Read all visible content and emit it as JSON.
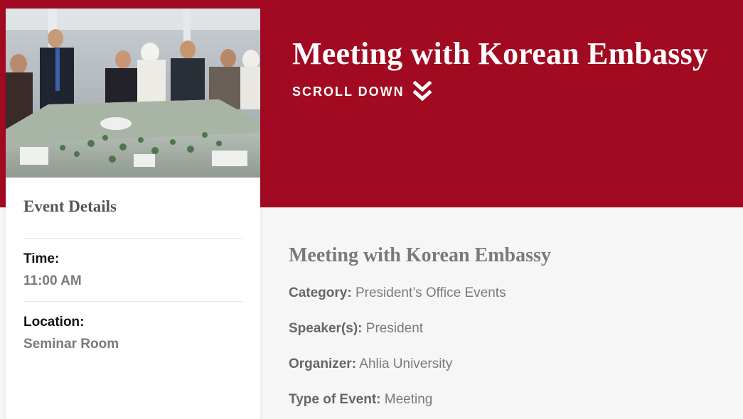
{
  "hero": {
    "title": "Meeting with Korean Embassy",
    "scroll_label": "SCROLL DOWN"
  },
  "colors": {
    "brand": "#a20a22",
    "background": "#f6f6f6",
    "muted_text": "#7a7a7a"
  },
  "event_details": {
    "heading": "Event Details",
    "time_label": "Time:",
    "time_value": "11:00 AM",
    "location_label": "Location:",
    "location_value": "Seminar Room"
  },
  "event_info": {
    "title": "Meeting with Korean Embassy",
    "rows": [
      {
        "label": "Category:",
        "value": "President’s Office Events"
      },
      {
        "label": "Speaker(s):",
        "value": "President"
      },
      {
        "label": "Organizer:",
        "value": "Ahlia University"
      },
      {
        "label": "Type of Event:",
        "value": "Meeting"
      }
    ]
  },
  "icons": {
    "scroll": "double-chevron-down-icon"
  }
}
